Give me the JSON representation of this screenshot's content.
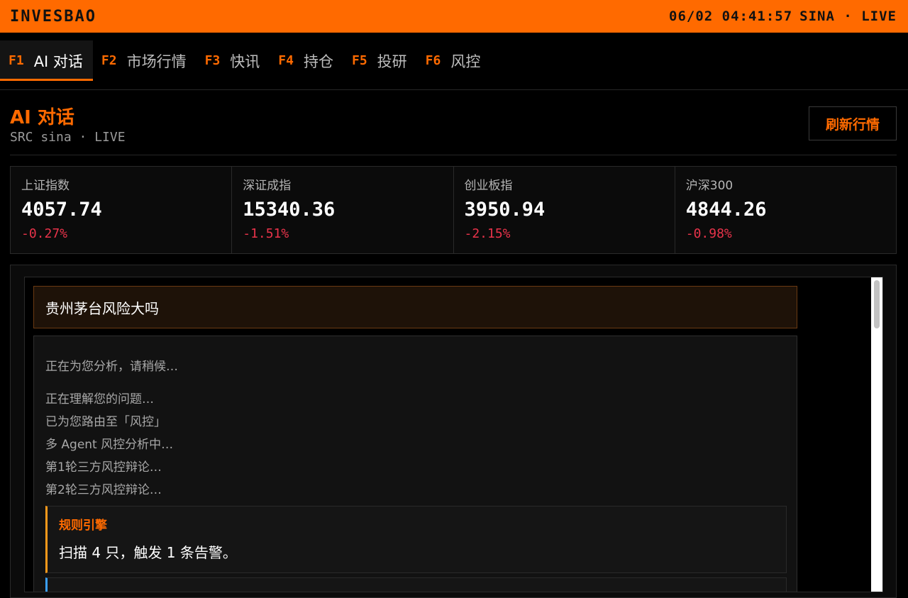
{
  "app": {
    "brand": "INVESBAO",
    "datetime": "06/02 04:41:57",
    "source_status": "SINA · LIVE"
  },
  "tabs": [
    {
      "key": "F1",
      "label": "AI 对话",
      "active": true
    },
    {
      "key": "F2",
      "label": "市场行情",
      "active": false
    },
    {
      "key": "F3",
      "label": "快讯",
      "active": false
    },
    {
      "key": "F4",
      "label": "持仓",
      "active": false
    },
    {
      "key": "F5",
      "label": "投研",
      "active": false
    },
    {
      "key": "F6",
      "label": "风控",
      "active": false
    }
  ],
  "header": {
    "title": "AI 对话",
    "subtitle": "SRC sina · LIVE",
    "refresh_label": "刷新行情"
  },
  "indices": [
    {
      "name": "上证指数",
      "value": "4057.74",
      "change": "-0.27%"
    },
    {
      "name": "深证成指",
      "value": "15340.36",
      "change": "-1.51%"
    },
    {
      "name": "创业板指",
      "value": "3950.94",
      "change": "-2.15%"
    },
    {
      "name": "沪深300",
      "value": "4844.26",
      "change": "-0.98%"
    }
  ],
  "chat": {
    "user_message": "贵州茅台风险大吗",
    "bot_lines": [
      "正在为您分析，请稍候…",
      "正在理解您的问题…",
      "已为您路由至「风控」",
      "多 Agent 风控分析中…",
      "第1轮三方风控辩论…",
      "第2轮三方风控辩论…"
    ],
    "rule_card": {
      "title": "规则引擎",
      "body": "扫描 4 只，触发 1 条告警。"
    }
  },
  "colors": {
    "accent": "#ff6a00",
    "down": "#e8334a",
    "rule_border": "#ff9a1a",
    "info_border": "#3aa0ff"
  }
}
